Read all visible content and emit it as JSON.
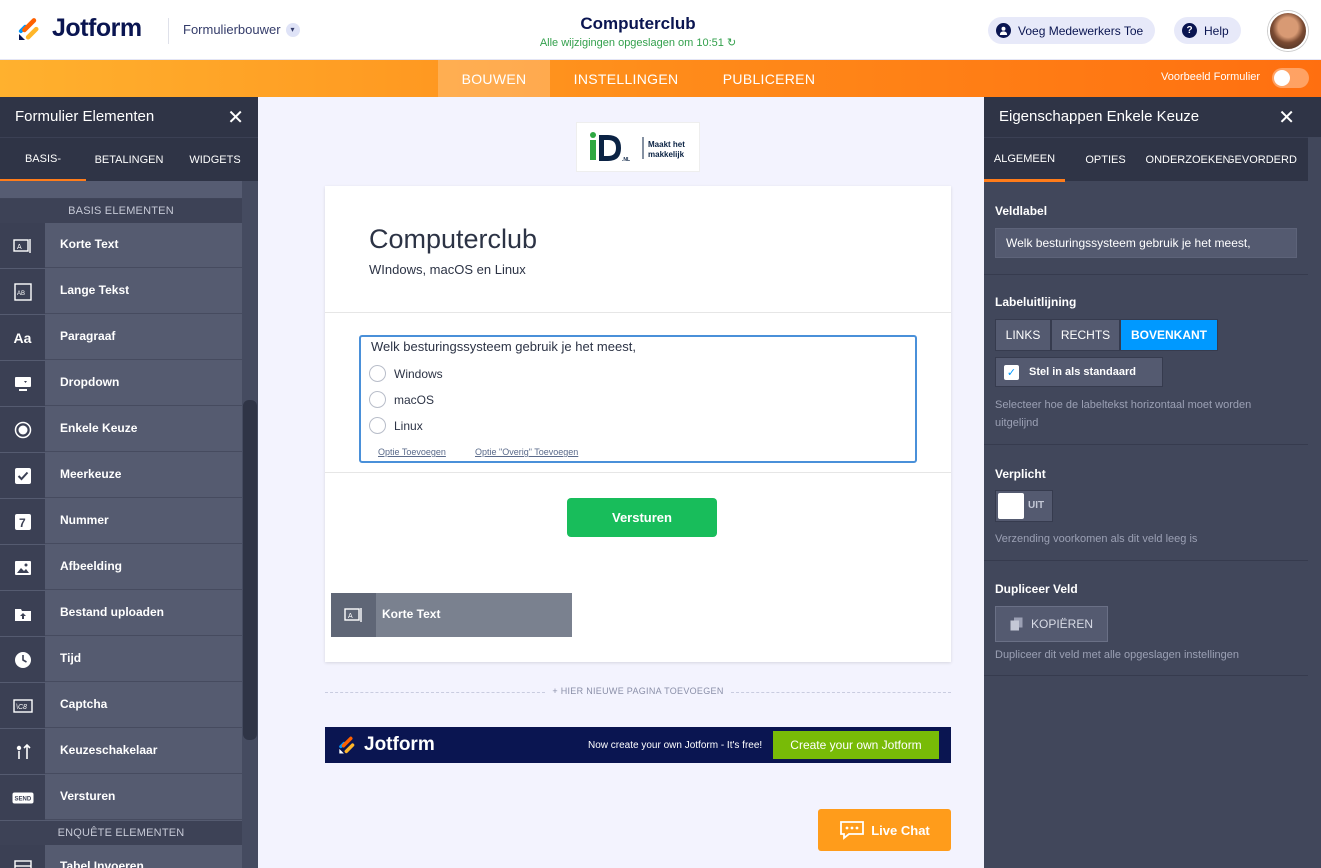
{
  "header": {
    "logo_text": "Jotform",
    "builder_selector": "Formulierbouwer",
    "form_title": "Computerclub",
    "saved_status": "Alle wijzigingen opgeslagen om 10:51",
    "collaborators_button": "Voeg Medewerkers Toe",
    "help_button": "Help"
  },
  "nav": {
    "tabs": [
      "BOUWEN",
      "INSTELLINGEN",
      "PUBLICEREN"
    ],
    "active": "BOUWEN",
    "preview_label": "Voorbeeld Formulier"
  },
  "left_panel": {
    "title": "Formulier Elementen",
    "tabs": [
      "BASIS-",
      "BETALINGEN",
      "WIDGETS"
    ],
    "section_basic": "BASIS ELEMENTEN",
    "items": [
      "Korte Text",
      "Lange Tekst",
      "Paragraaf",
      "Dropdown",
      "Enkele Keuze",
      "Meerkeuze",
      "Nummer",
      "Afbeelding",
      "Bestand uploaden",
      "Tijd",
      "Captcha",
      "Keuzeschakelaar",
      "Versturen"
    ],
    "section_survey": "ENQUÊTE ELEMENTEN",
    "next_item": "Tabel Invoeren"
  },
  "brand_logo": {
    "mark": "iD",
    "suffix": ".NL",
    "tagline_1": "Maakt het",
    "tagline_2": "makkelijk"
  },
  "form": {
    "title": "Computerclub",
    "subtitle": "WIndows, macOS en Linux",
    "question_label": "Welk besturingssysteem gebruik je het meest,",
    "options": [
      "Windows",
      "macOS",
      "Linux"
    ],
    "add_option_link": "Optie Toevoegen",
    "add_other_link": "Optie \"Overig\" Toevoegen",
    "submit_label": "Versturen",
    "drag_ghost_label": "Korte Text",
    "add_page": "+ HIER NIEUWE PAGINA TOEVOEGEN"
  },
  "banner": {
    "logo_text": "Jotform",
    "text": "Now create your own Jotform - It's free!",
    "button": "Create your own Jotform"
  },
  "livechat_label": "Live Chat",
  "right_panel": {
    "title": "Eigenschappen Enkele Keuze",
    "tabs": [
      "ALGEMEEN",
      "OPTIES",
      "ONDERZOEKEN",
      "GEVORDERD"
    ],
    "field_label_heading": "Veldlabel",
    "field_label_value": "Welk besturingssysteem gebruik je het meest,",
    "alignment_heading": "Labeluitlijning",
    "alignment_options": [
      "LINKS",
      "RECHTS",
      "BOVENKANT"
    ],
    "alignment_selected": "BOVENKANT",
    "set_default_label": "Stel in als standaard",
    "set_default_checked": true,
    "alignment_help": "Selecteer hoe de labeltekst horizontaal moet worden uitgelijnd",
    "required_heading": "Verplicht",
    "required_state": "UIT",
    "required_help": "Verzending voorkomen als dit veld leeg is",
    "duplicate_heading": "Dupliceer Veld",
    "copy_button": "KOPIËREN",
    "duplicate_help": "Dupliceer dit veld met alle opgeslagen instellingen"
  },
  "colors": {
    "navy": "#0a1551",
    "orange": "#ff8c1a",
    "green_submit": "#18bd5b",
    "blue_selected": "#0099ff"
  }
}
